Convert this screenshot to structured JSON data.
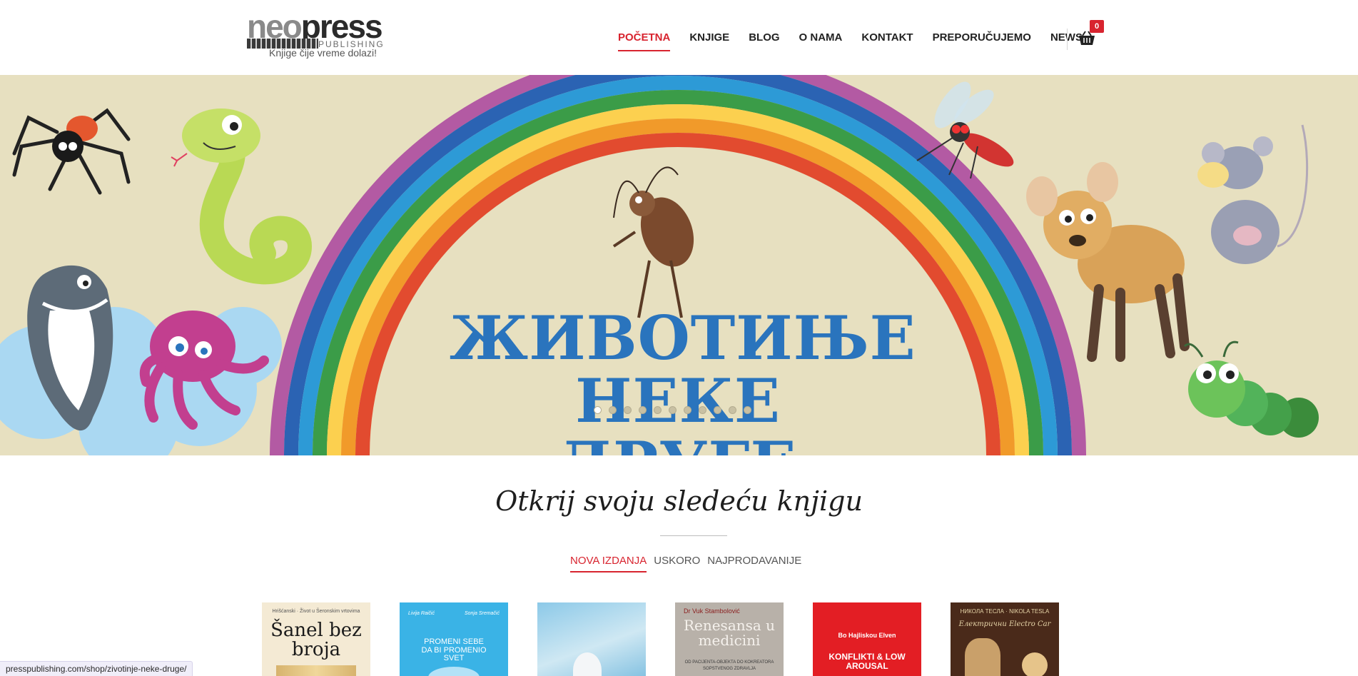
{
  "logo": {
    "neo": "neo",
    "press": "press",
    "sub": "PUBLISHING",
    "tagline": "Knjige čije vreme dolazi!"
  },
  "nav": {
    "items": [
      "POČETNA",
      "KNJIGE",
      "BLOG",
      "O NAMA",
      "KONTAKT",
      "PREPORUČUJEMO",
      "NEWS"
    ],
    "active_index": 0,
    "cart_count": "0"
  },
  "hero": {
    "title_line1": "ЖИВОТИЊЕ",
    "title_line2": "НЕКЕ ДРУГЕ",
    "slide_count": 11,
    "active_slide": 0
  },
  "section": {
    "title": "Otkrij svoju sledeću knjigu",
    "tabs": [
      "NOVA IZDANJA",
      "USKORO",
      "NAJPRODAVANIJE"
    ],
    "active_tab": 0
  },
  "books": [
    {
      "top": "Hrišćanski · Život u Šeronskim vrtovima",
      "title": "Šanel bez broja",
      "author_l": "",
      "author_r": ""
    },
    {
      "top": "",
      "title": "PROMENI SEBE DA BI PROMENIO SVET",
      "author_l": "Livija Raičić",
      "author_r": "Sonja Sremačić"
    },
    {
      "top": "",
      "title": "",
      "author_l": "",
      "author_r": ""
    },
    {
      "top": "Dr Vuk Stambolović",
      "title": "Renesansa u medicini",
      "sub": "OD PACIJENTA-OBJEKTA DO KOKREATORA SOPSTVENOG ZDRAVLJA",
      "author_l": "",
      "author_r": ""
    },
    {
      "top": "Bo Hajliskou Elven",
      "title": "KONFLIKTI & LOW AROUSAL",
      "author_l": "",
      "author_r": ""
    },
    {
      "top": "НИКОЛА ТЕСЛА · NIKOLA TESLA",
      "title": "Електрични Electro Car",
      "author_l": "",
      "author_r": ""
    }
  ],
  "status_bar": {
    "url": "presspublishing.com/shop/zivotinje-neke-druge/"
  },
  "colors": {
    "accent": "#d8242f",
    "hero_bg": "#e7e0c0",
    "hero_title": "#2a74bd"
  }
}
